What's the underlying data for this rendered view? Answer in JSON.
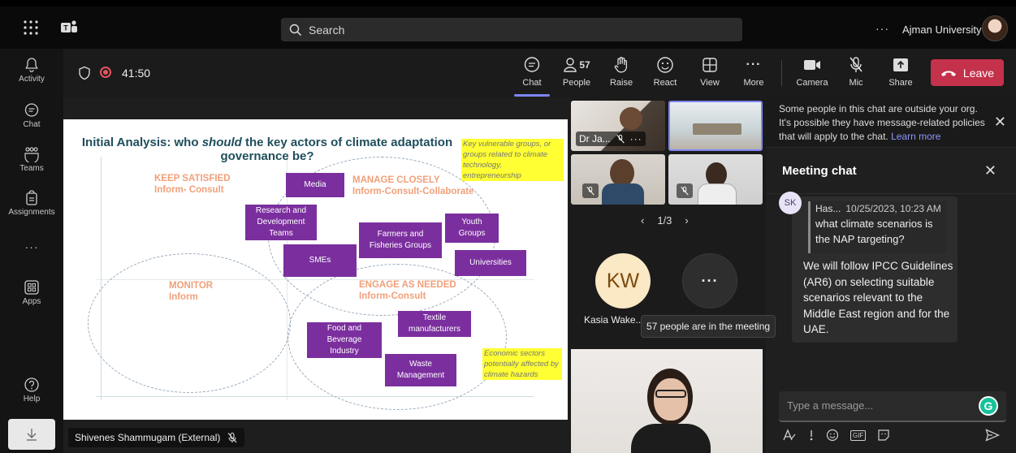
{
  "titlebar": {
    "search_placeholder": "Search",
    "more": "···",
    "org_name": "Ajman University"
  },
  "rail": {
    "items": [
      {
        "label": "Activity",
        "icon": "bell-icon"
      },
      {
        "label": "Chat",
        "icon": "chat-icon"
      },
      {
        "label": "Teams",
        "icon": "teams-icon"
      },
      {
        "label": "Assignments",
        "icon": "assignments-icon"
      },
      {
        "label": "···",
        "icon": "more-icon"
      },
      {
        "label": "Apps",
        "icon": "apps-icon"
      },
      {
        "label": "Help",
        "icon": "help-icon"
      }
    ]
  },
  "toolbar": {
    "timer": "41:50",
    "buttons": {
      "chat": "Chat",
      "people": "People",
      "people_count": "57",
      "raise": "Raise",
      "react": "React",
      "view": "View",
      "more": "More",
      "camera": "Camera",
      "mic": "Mic",
      "share": "Share"
    },
    "leave": "Leave"
  },
  "slide": {
    "title_a": "Initial Analysis: who ",
    "title_em": "should",
    "title_b": " the key actors of climate adaptation governance be?",
    "quadrants": {
      "keep_satisfied": "KEEP SATISFIED",
      "keep_satisfied_sub": "Inform- Consult",
      "manage_closely": "MANAGE CLOSELY",
      "manage_closely_sub": "Inform-Consult-Collaborate",
      "monitor": "MONITOR",
      "monitor_sub": "Inform",
      "engage": "ENGAGE AS NEEDED",
      "engage_sub": "Inform-Consult"
    },
    "boxes": {
      "media": "Media",
      "rnd": "Research and Development Teams",
      "farmers": "Farmers and Fisheries Groups",
      "youth": "Youth Groups",
      "smes": "SMEs",
      "universities": "Universities",
      "textile": "Textile manufacturers",
      "food": "Food and Beverage Industry",
      "waste": "Waste Management"
    },
    "notes": {
      "top": "Key vulnerable groups, or groups related to climate technology, entrepreneurship",
      "bottom": "Economic sectors potentially affected by climate hazards"
    }
  },
  "presenter": "Shivenes Shammugam (External)",
  "participants": {
    "tile1_name": "Dr Ja...",
    "pager": "1/3",
    "kw_initials": "KW",
    "kw_name": "Kasia Wake...",
    "tooltip": "57 people are in the meeting"
  },
  "chat": {
    "banner_text": "Some people in this chat are outside your org. It's possible they have message-related policies that will apply to the chat. ",
    "banner_link": "Learn more",
    "heading": "Meeting chat",
    "sender_initials": "SK",
    "quote_author": "Has...",
    "quote_time": "10/25/2023, 10:23 AM",
    "quote_text": "what climate scenarios is the NAP targeting?",
    "message": "We will follow IPCC Guidelines (AR6) on selecting suitable scenarios relevant to the Middle East region and for the UAE.",
    "compose_placeholder": "Type a message...",
    "grammarly": "G"
  },
  "colors": {
    "accent": "#7f85f5",
    "leave": "#c4314b",
    "slide_box": "#7b2f9e",
    "quadrant_label": "#f0a07a",
    "note_bg": "#ffff33"
  }
}
